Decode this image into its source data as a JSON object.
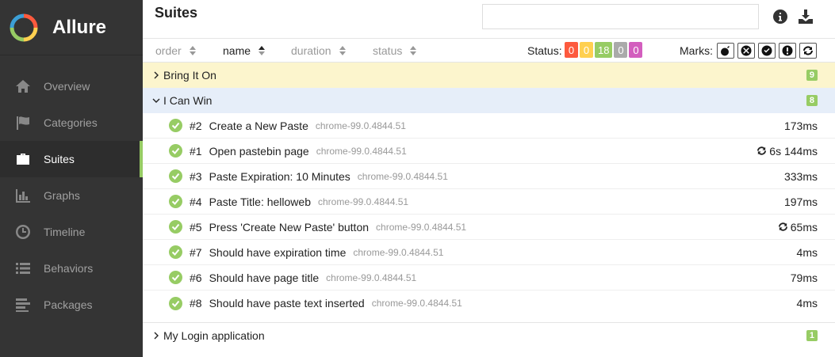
{
  "brand": {
    "name": "Allure"
  },
  "nav": [
    {
      "label": "Overview",
      "icon": "home-icon",
      "active": false
    },
    {
      "label": "Categories",
      "icon": "flag-icon",
      "active": false
    },
    {
      "label": "Suites",
      "icon": "briefcase-icon",
      "active": true
    },
    {
      "label": "Graphs",
      "icon": "bar-chart-icon",
      "active": false
    },
    {
      "label": "Timeline",
      "icon": "clock-icon",
      "active": false
    },
    {
      "label": "Behaviors",
      "icon": "list-icon",
      "active": false
    },
    {
      "label": "Packages",
      "icon": "align-left-icon",
      "active": false
    }
  ],
  "header": {
    "title": "Suites",
    "search_value": ""
  },
  "toolbar": {
    "sort": {
      "order": "order",
      "name": "name",
      "duration": "duration",
      "status": "status"
    },
    "status_label": "Status:",
    "marks_label": "Marks:",
    "badges": [
      {
        "value": "0",
        "color": "#fd5a3e"
      },
      {
        "value": "0",
        "color": "#ffd050"
      },
      {
        "value": "18",
        "color": "#97cc64"
      },
      {
        "value": "0",
        "color": "#aaaaaa"
      },
      {
        "value": "0",
        "color": "#d35ebe"
      }
    ]
  },
  "groups": [
    {
      "name": "Bring It On",
      "count": "9",
      "expanded": false
    },
    {
      "name": "I Can Win",
      "count": "8",
      "expanded": true
    },
    {
      "name": "My Login application",
      "count": "1",
      "expanded": false
    }
  ],
  "tests": [
    {
      "num": "#2",
      "name": "Create a New Paste",
      "env": "chrome-99.0.4844.51",
      "duration": "173ms",
      "retry": false
    },
    {
      "num": "#1",
      "name": "Open pastebin page",
      "env": "chrome-99.0.4844.51",
      "duration": "6s 144ms",
      "retry": true
    },
    {
      "num": "#3",
      "name": "Paste Expiration: 10 Minutes",
      "env": "chrome-99.0.4844.51",
      "duration": "333ms",
      "retry": false
    },
    {
      "num": "#4",
      "name": "Paste Title: helloweb",
      "env": "chrome-99.0.4844.51",
      "duration": "197ms",
      "retry": false
    },
    {
      "num": "#5",
      "name": "Press 'Create New Paste' button",
      "env": "chrome-99.0.4844.51",
      "duration": "65ms",
      "retry": true
    },
    {
      "num": "#7",
      "name": "Should have expiration time",
      "env": "chrome-99.0.4844.51",
      "duration": "4ms",
      "retry": false
    },
    {
      "num": "#6",
      "name": "Should have page title",
      "env": "chrome-99.0.4844.51",
      "duration": "79ms",
      "retry": false
    },
    {
      "num": "#8",
      "name": "Should have paste text inserted",
      "env": "chrome-99.0.4844.51",
      "duration": "4ms",
      "retry": false
    }
  ]
}
